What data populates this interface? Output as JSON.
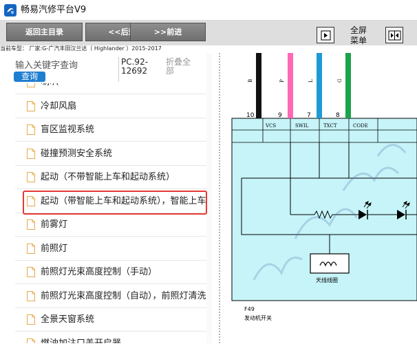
{
  "window": {
    "title": "畅易汽修平台V9"
  },
  "toolbar": {
    "back_main": "返回主目录",
    "back": "<<后退.",
    "forward": ">>前进",
    "fullscreen_label": "全屏",
    "menu_label": "菜单"
  },
  "vehicle": {
    "current_model": "当前车型：  厂家:G-广汽丰田汉兰达（ Highlander ）2015-2017"
  },
  "search": {
    "placeholder": "输入关键字查询",
    "button": "查询",
    "code": "PC.92-12692",
    "collapse_all": "折叠全部"
  },
  "tree": {
    "items": [
      {
        "label": "喇叭"
      },
      {
        "label": "冷却风扇"
      },
      {
        "label": "盲区监视系统"
      },
      {
        "label": "碰撞预测安全系统"
      },
      {
        "label": "起动（不带智能上车和起动系统）"
      },
      {
        "label": "起动（带智能上车和起动系统），智能上车"
      },
      {
        "label": "前雾灯"
      },
      {
        "label": "前照灯"
      },
      {
        "label": "前照灯光束高度控制（手动）"
      },
      {
        "label": "前照灯光束高度控制（自动），前照灯清洗"
      },
      {
        "label": "全景天窗系统"
      },
      {
        "label": "燃油加注口盖开启器"
      }
    ],
    "selected_index": 5
  },
  "diagram": {
    "wires": [
      {
        "code": "B",
        "pin": "10",
        "signal": "VCS",
        "color": "#111111"
      },
      {
        "code": "P",
        "pin": "9",
        "signal": "SWIL",
        "color": "#ff69b4"
      },
      {
        "code": "L",
        "pin": "7",
        "signal": "TXCT",
        "color": "#1e9ad6"
      },
      {
        "code": "G",
        "pin": "8",
        "signal": "CODE",
        "color": "#1aa34a"
      }
    ],
    "coil_label": "天线线圈",
    "connector_id": "F49",
    "component_name": "发动机开关",
    "fill_color": "#c6f4f8"
  },
  "colors": {
    "button_bg": "#7d7d7d",
    "accent_blue": "#1f7ed0",
    "highlight_red": "#e53935"
  }
}
